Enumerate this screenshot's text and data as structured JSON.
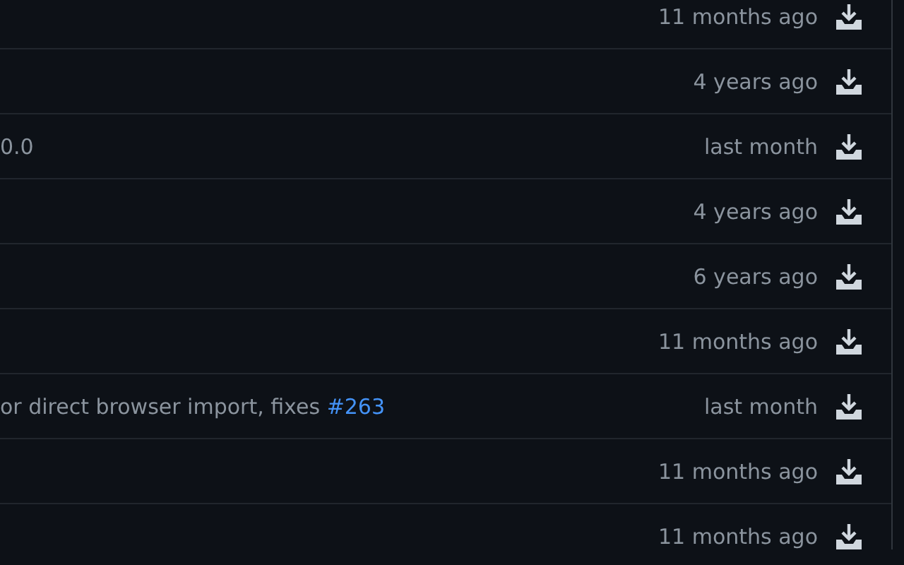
{
  "rows": [
    {
      "time": "11 months ago"
    },
    {
      "time": "4 years ago"
    },
    {
      "message": "0.0",
      "time": "last month"
    },
    {
      "time": "4 years ago"
    },
    {
      "time": "6 years ago"
    },
    {
      "time": "11 months ago"
    },
    {
      "message": "or direct browser import, fixes",
      "link": "#263",
      "time": "last month"
    },
    {
      "time": "11 months ago"
    },
    {
      "time": "11 months ago"
    }
  ]
}
